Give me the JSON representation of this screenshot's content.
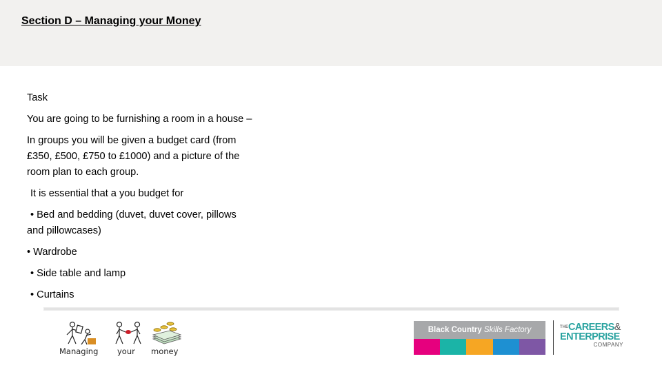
{
  "header": {
    "title": "Section D – Managing your Money",
    "background": "#f2f1ef"
  },
  "body": {
    "heading": "Task",
    "intro": "You are going to be furnishing a room in a house –",
    "groups_line1": "In groups you will be given a budget card (from",
    "groups_line2": "£350, £500, £750 to £1000) and a picture of the",
    "groups_line3": "room plan to each group.",
    "essential": "It is essential that a you budget for",
    "items": [
      {
        "bullet": "•",
        "line1": "Bed and bedding (duvet, duvet cover, pillows",
        "line2": "and pillowcases)"
      },
      {
        "bullet": "•",
        "line1": "Wardrobe"
      },
      {
        "bullet": "•",
        "line1": "Side table and lamp"
      },
      {
        "bullet": "•",
        "line1": "Curtains"
      }
    ]
  },
  "symbols": [
    {
      "icon": "managing-symbol-icon",
      "label": "Managing"
    },
    {
      "icon": "your-symbol-icon",
      "label": "your"
    },
    {
      "icon": "money-symbol-icon",
      "label": "money"
    }
  ],
  "logos": {
    "bcsf": {
      "name_bold": "Black Country",
      "name_italic": "Skills Factory",
      "colors": [
        "#e6007e",
        "#1bb4a7",
        "#f6a623",
        "#1e90d2",
        "#7e57a5"
      ],
      "gray": "#a7a8aa"
    },
    "cec": {
      "the": "THE",
      "line1": "CAREERS",
      "amp": "&",
      "line2": "ENTERPRISE",
      "line3": "COMPANY",
      "color": "#2aa3a0"
    }
  }
}
